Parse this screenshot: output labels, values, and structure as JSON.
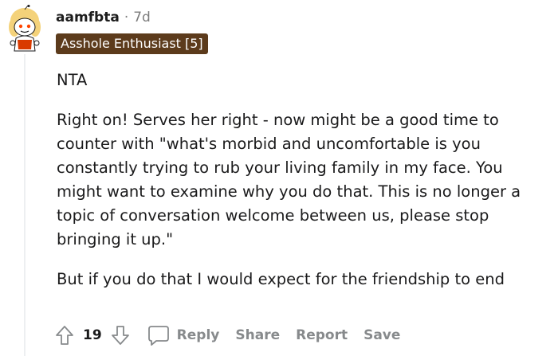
{
  "comment": {
    "username": "aamfbta",
    "separator": "·",
    "age": "7d",
    "flair": "Asshole Enthusiast [5]",
    "paragraphs": [
      "NTA",
      "Right on! Serves her right - now might be a good time to counter with \"what's morbid and uncomfortable is you constantly trying to rub your living family in my face. You might want to examine why you do that. This is no longer a topic of conversation welcome between us, please stop bringing it up.\"",
      "But if you do that I would expect for the friendship to end"
    ]
  },
  "actions": {
    "score": "19",
    "reply_label": "Reply",
    "share_label": "Share",
    "report_label": "Report",
    "save_label": "Save"
  },
  "colors": {
    "flair_bg": "#5c3b1c",
    "muted": "#878a8c",
    "text": "#1a1a1b"
  },
  "icons": {
    "avatar": "snoo-avatar-icon",
    "upvote": "upvote-arrow-icon",
    "downvote": "downvote-arrow-icon",
    "reply": "speech-bubble-icon"
  }
}
